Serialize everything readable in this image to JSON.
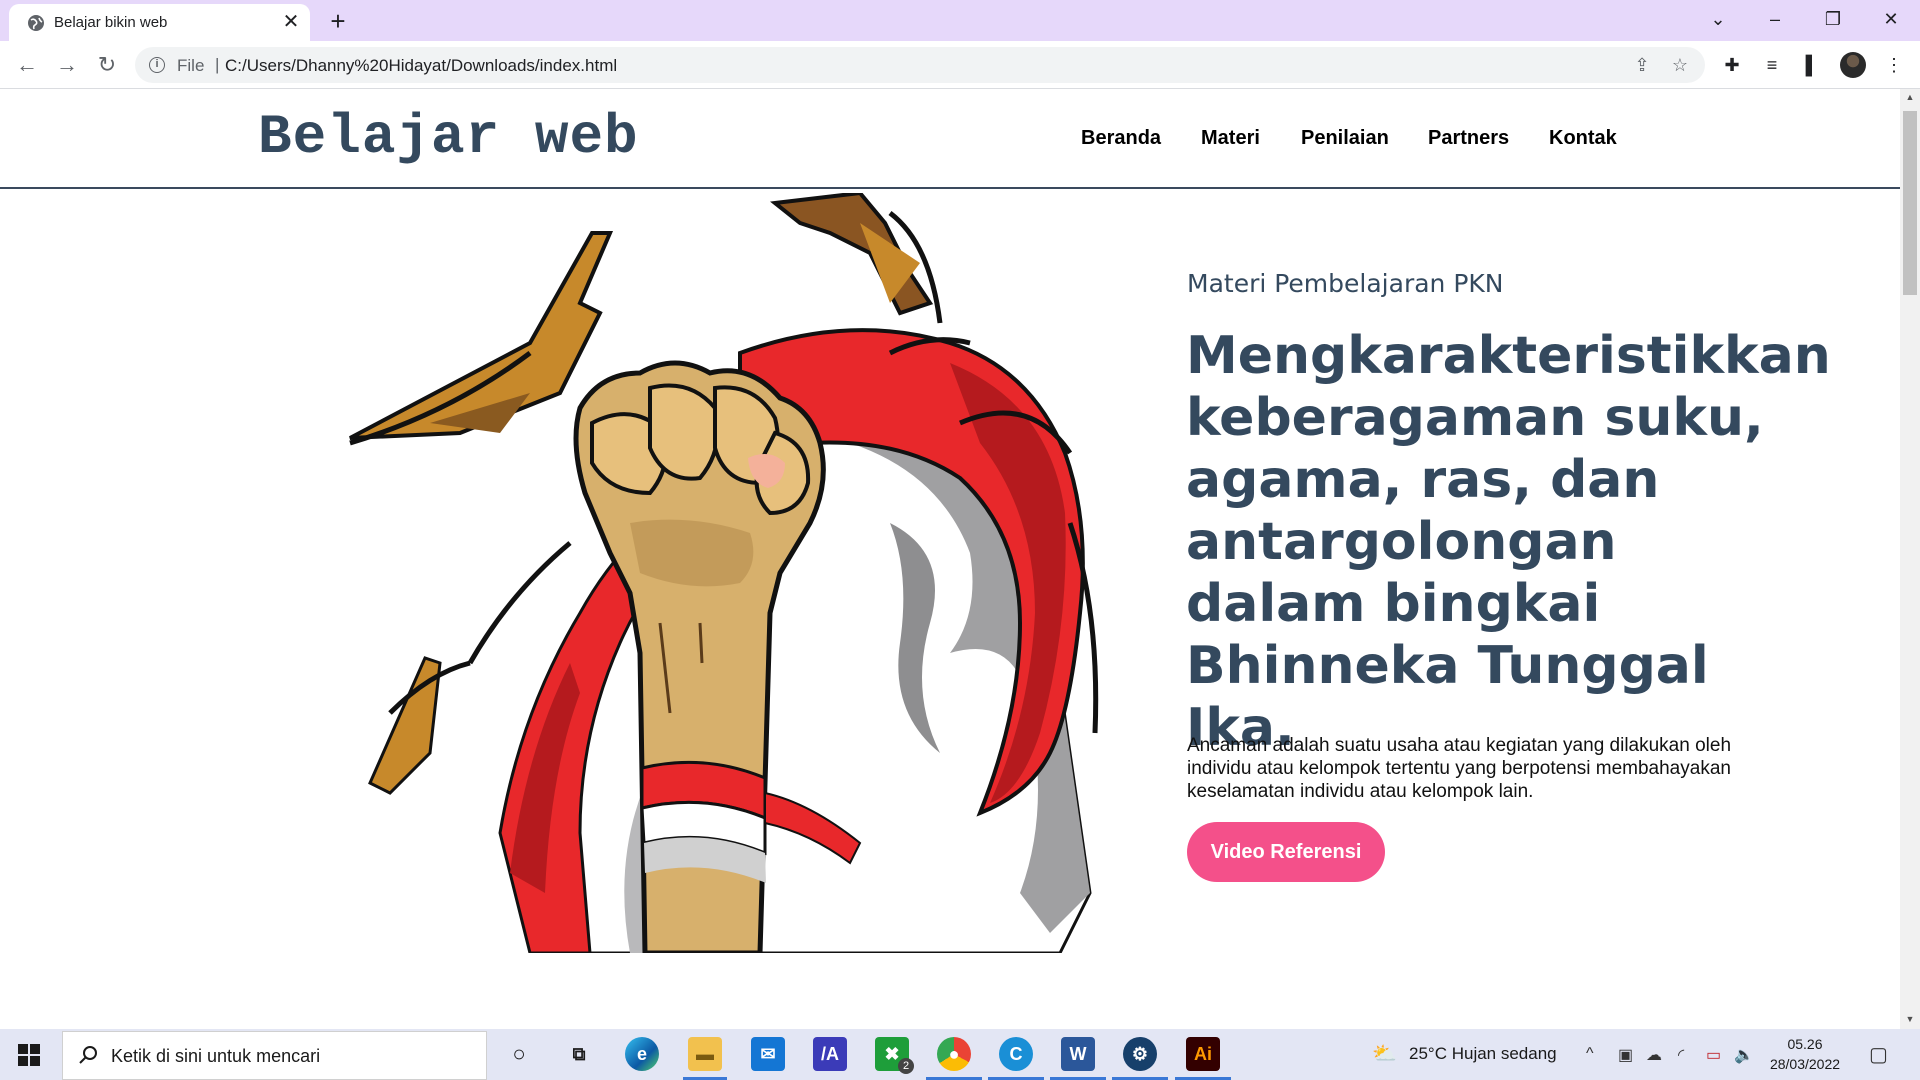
{
  "browser": {
    "tab_title": "Belajar bikin web",
    "tab_close": "✕",
    "new_tab": "+",
    "omnibox": {
      "scheme": "File",
      "url": "C:/Users/Dhanny%20Hidayat/Downloads/index.html"
    }
  },
  "page": {
    "logo": "Belajar web",
    "nav": [
      "Beranda",
      "Materi",
      "Penilaian",
      "Partners",
      "Kontak"
    ],
    "hero": {
      "subtitle": "Materi Pembelajaran PKN",
      "headline": "Mengkarakteristikkan keberagaman suku, agama, ras, dan antargolongan dalam bingkai Bhinneka Tunggal Ika.",
      "description": "Ancaman adalah suatu usaha atau kegiatan yang dilakukan oleh individu atau kelompok tertentu yang berpotensi membahayakan keselamatan individu atau kelompok lain.",
      "cta": "Video Referensi"
    },
    "colors": {
      "heading": "#34495e",
      "cta": "#f4508a",
      "flag_red": "#e8282b"
    }
  },
  "taskbar": {
    "search_placeholder": "Ketik di sini untuk mencari",
    "weather": "25°C  Hujan sedang",
    "time": "05.26",
    "date": "28/03/2022",
    "xbox_badge": "2",
    "app_icons": [
      "cortana-icon",
      "task-view-icon",
      "edge-icon",
      "file-explorer-icon",
      "mail-icon",
      "vscode-icon",
      "xbox-icon",
      "chrome-icon",
      "cisco-webex-icon",
      "word-icon",
      "steam-icon",
      "illustrator-icon"
    ]
  }
}
